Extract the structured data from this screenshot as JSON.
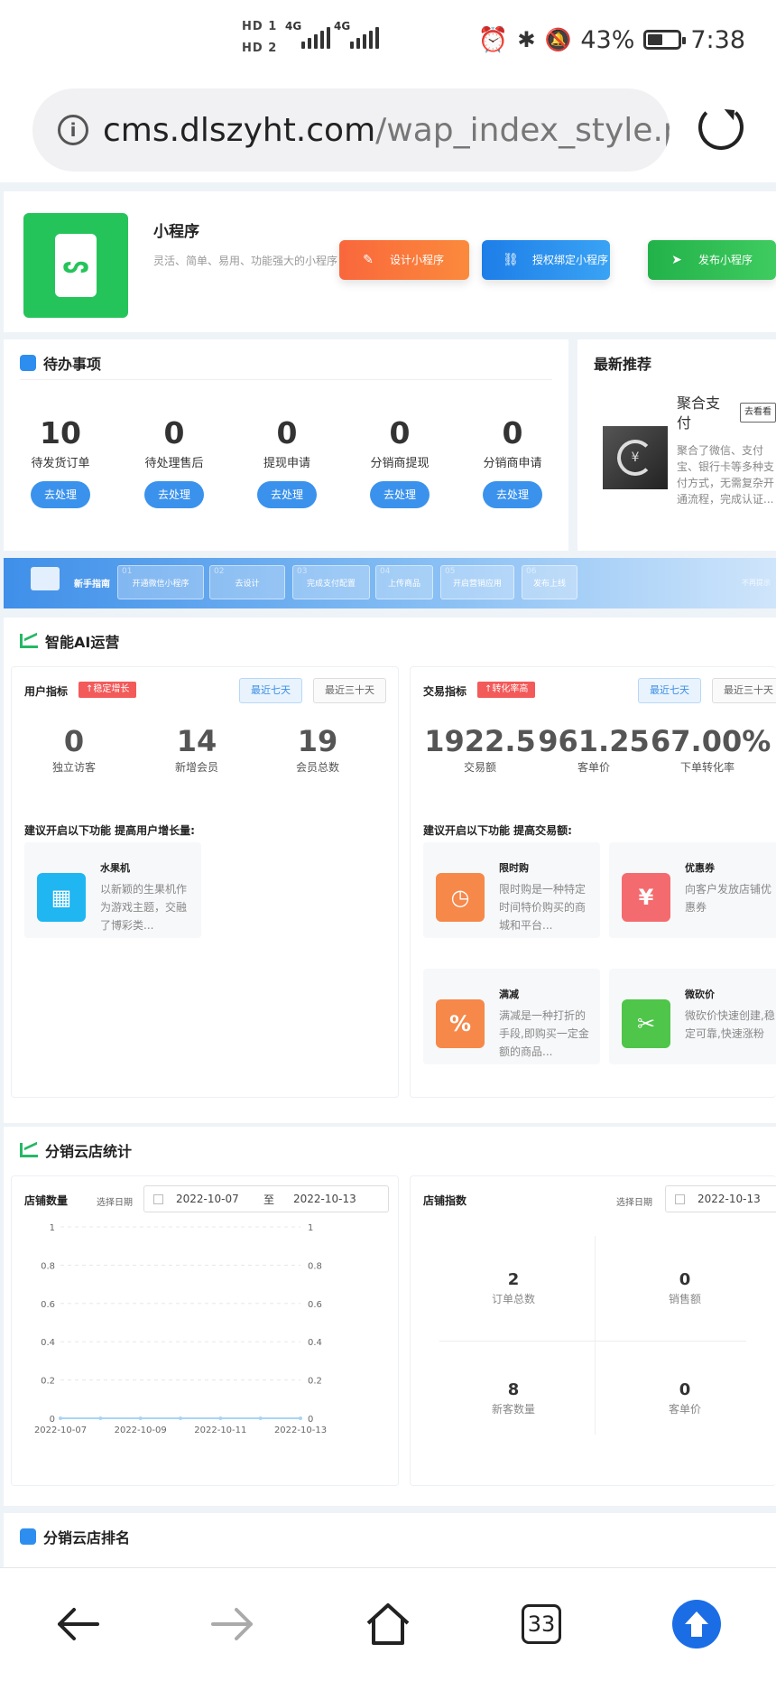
{
  "status_bar": {
    "sim1_label": "HD 1",
    "sim2_label": "HD 2",
    "network1": "4G",
    "network2": "4G",
    "battery": "43%",
    "time": "7:38"
  },
  "browser": {
    "url_domain": "cms.dlszyht.com",
    "url_path": "/wap_index_style.php",
    "tab_count": "33"
  },
  "mini_program": {
    "title": "小程序",
    "description": "灵活、简单、易用、功能强大的小程序",
    "buttons": [
      {
        "label": "设计小程序",
        "icon": "edit-icon"
      },
      {
        "label": "授权绑定小程序",
        "icon": "link-icon"
      },
      {
        "label": "发布小程序",
        "icon": "send-icon"
      }
    ]
  },
  "todo": {
    "title": "待办事项",
    "items": [
      {
        "count": "10",
        "label": "待发货订单",
        "action": "去处理"
      },
      {
        "count": "0",
        "label": "待处理售后",
        "action": "去处理"
      },
      {
        "count": "0",
        "label": "提现申请",
        "action": "去处理"
      },
      {
        "count": "0",
        "label": "分销商提现",
        "action": "去处理"
      },
      {
        "count": "0",
        "label": "分销商申请",
        "action": "去处理"
      }
    ]
  },
  "recommend": {
    "title": "最新推荐",
    "item_title": "聚合支付",
    "item_button": "去看看",
    "item_desc": "聚合了微信、支付宝、银行卡等多种支付方式，无需复杂开通流程，完成认证..."
  },
  "guide_banner": {
    "label": "新手指南",
    "steps": [
      {
        "no": "01",
        "label": "开通微信小程序"
      },
      {
        "no": "02",
        "label": "去设计"
      },
      {
        "no": "03",
        "label": "完成支付配置"
      },
      {
        "no": "04",
        "label": "上传商品"
      },
      {
        "no": "05",
        "label": "开启营销应用"
      },
      {
        "no": "06",
        "label": "发布上线"
      }
    ],
    "right_text": "不再提示"
  },
  "ai_ops": {
    "title": "智能AI运营",
    "user_panel": {
      "title": "用户指标",
      "tag": "↑稳定增长",
      "range_buttons": [
        "最近七天",
        "最近三十天"
      ],
      "metrics": [
        {
          "value": "0",
          "label": "独立访客"
        },
        {
          "value": "14",
          "label": "新增会员"
        },
        {
          "value": "19",
          "label": "会员总数"
        }
      ],
      "hint": "建议开启以下功能 提高用户增长量:",
      "features": [
        {
          "title": "水果机",
          "desc": "以新颖的生果机作为游戏主题，交融了博彩类...",
          "icon": "slot-machine-icon",
          "color": "#1fb6f2"
        }
      ]
    },
    "trade_panel": {
      "title": "交易指标",
      "tag": "↑转化率高",
      "range_buttons": [
        "最近七天",
        "最近三十天"
      ],
      "metrics": [
        {
          "value": "1922.5",
          "label": "交易额"
        },
        {
          "value": "961.25",
          "label": "客单价"
        },
        {
          "value": "67.00%",
          "label": "下单转化率"
        }
      ],
      "hint": "建议开启以下功能 提高交易额:",
      "features": [
        {
          "title": "限时购",
          "desc": "限时购是一种特定时间特价购买的商城和平台...",
          "icon": "timer-icon",
          "color": "#f6884a"
        },
        {
          "title": "优惠券",
          "desc": "向客户发放店铺优惠券",
          "icon": "coupon-icon",
          "color": "#f46b6f"
        },
        {
          "title": "满减",
          "desc": "满减是一种打折的手段,即购买一定金额的商品...",
          "icon": "percent-icon",
          "color": "#f6884a"
        },
        {
          "title": "微砍价",
          "desc": "微砍价快速创建,稳定可靠,快速涨粉",
          "icon": "bargain-icon",
          "color": "#4fc54a"
        }
      ]
    }
  },
  "distribution_stats": {
    "title": "分销云店统计",
    "store_count_panel": {
      "title": "店铺数量",
      "date_label": "选择日期",
      "date_from": "2022-10-07",
      "date_sep": "至",
      "date_to": "2022-10-13"
    },
    "store_index_panel": {
      "title": "店铺指数",
      "date_label": "选择日期",
      "date_from": "2022-10-13",
      "stats": [
        {
          "value": "2",
          "label": "订单总数"
        },
        {
          "value": "0",
          "label": "销售额"
        },
        {
          "value": "8",
          "label": "新客数量"
        },
        {
          "value": "0",
          "label": "客单价"
        }
      ]
    }
  },
  "chart_data": {
    "type": "line",
    "title": "店铺数量",
    "xlabel": "",
    "ylabel": "",
    "x": [
      "2022-10-07",
      "2022-10-08",
      "2022-10-09",
      "2022-10-10",
      "2022-10-11",
      "2022-10-12",
      "2022-10-13"
    ],
    "x_tick_labels": [
      "2022-10-07",
      "2022-10-09",
      "2022-10-11",
      "2022-10-13"
    ],
    "series": [
      {
        "values": [
          0,
          0,
          0,
          0,
          0,
          0,
          0
        ]
      }
    ],
    "y_ticks": [
      0,
      0.2,
      0.4,
      0.6,
      0.8,
      1
    ],
    "ylim": [
      0,
      1
    ],
    "dual_y_axis": true,
    "grid": "horizontal-dashed"
  },
  "ranking": {
    "title": "分销云店排名"
  }
}
